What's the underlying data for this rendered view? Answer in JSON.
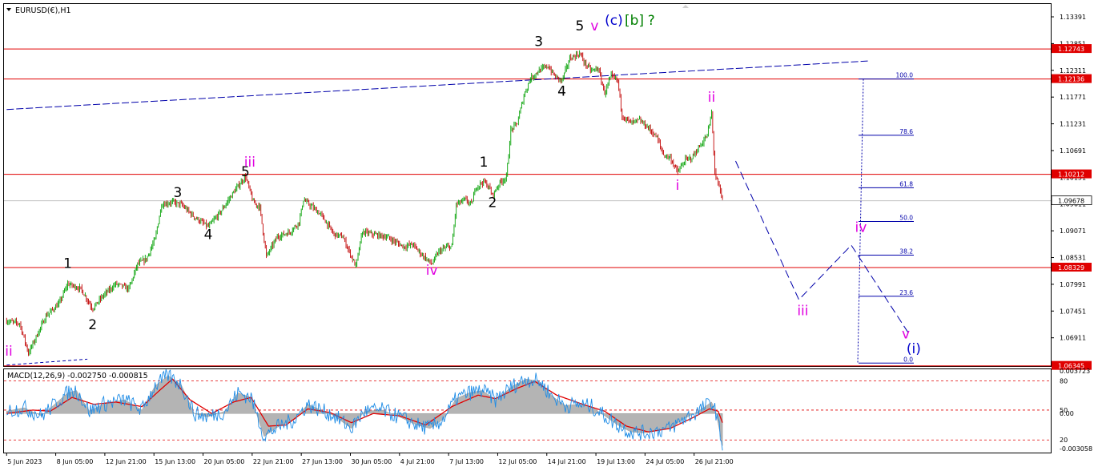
{
  "chart_data": {
    "type": "candlestick",
    "symbol_label": "EURUSD(€),H1",
    "price_panel": {
      "ylim": [
        1.0634,
        1.1365
      ],
      "y_ticks": [
        1.13391,
        1.12851,
        1.12311,
        1.11771,
        1.11231,
        1.10691,
        1.10151,
        1.09611,
        1.09071,
        1.08531,
        1.07991,
        1.07451,
        1.06911
      ],
      "y_tick_labels": [
        "1.13391",
        "1.12851",
        "1.12311",
        "1.11771",
        "1.11231",
        "1.10691",
        "1.10151",
        "1.09611",
        "1.09071",
        "1.08531",
        "1.07991",
        "1.07451",
        "1.06911"
      ],
      "horizontal_levels": [
        {
          "price": 1.12743,
          "label": "1.12743",
          "color": "#e00000"
        },
        {
          "price": 1.12136,
          "label": "1.12136",
          "color": "#e00000"
        },
        {
          "price": 1.10212,
          "label": "1.10212",
          "color": "#e00000"
        },
        {
          "price": 1.08329,
          "label": "1.08329",
          "color": "#e00000"
        },
        {
          "price": 1.06345,
          "label": "1.06345",
          "color": "#e00000"
        }
      ],
      "current_price": {
        "price": 1.09678,
        "label": "1.09678"
      },
      "fibonacci_levels": [
        {
          "label": "100.0",
          "price": 1.12136
        },
        {
          "label": "78.6",
          "price": 1.11
        },
        {
          "label": "61.8",
          "price": 1.0994
        },
        {
          "label": "50.0",
          "price": 1.0926
        },
        {
          "label": "38.2",
          "price": 1.0858
        },
        {
          "label": "23.6",
          "price": 1.0775
        },
        {
          "label": "0.0",
          "price": 1.064
        }
      ],
      "wave_labels": [
        {
          "text": "ii",
          "color": "#e000e0",
          "x": 0.5,
          "price": 1.0655
        },
        {
          "text": "1",
          "color": "#000000",
          "x": 14,
          "price": 1.0832
        },
        {
          "text": "2",
          "color": "#000000",
          "x": 19.7,
          "price": 1.0708
        },
        {
          "text": "3",
          "color": "#000000",
          "x": 39.2,
          "price": 1.0975
        },
        {
          "text": "4",
          "color": "#000000",
          "x": 46.2,
          "price": 1.089
        },
        {
          "text": "5",
          "color": "#000000",
          "x": 54.7,
          "price": 1.1017
        },
        {
          "text": "iii",
          "color": "#e000e0",
          "x": 55.7,
          "price": 1.1037
        },
        {
          "text": "iv",
          "color": "#e000e0",
          "x": 97.4,
          "price": 1.0818
        },
        {
          "text": "1",
          "color": "#000000",
          "x": 109.3,
          "price": 1.1037
        },
        {
          "text": "2",
          "color": "#000000",
          "x": 111.3,
          "price": 1.0955
        },
        {
          "text": "3",
          "color": "#000000",
          "x": 121.9,
          "price": 1.128
        },
        {
          "text": "4",
          "color": "#000000",
          "x": 127.2,
          "price": 1.118
        },
        {
          "text": "5",
          "color": "#000000",
          "x": 131.3,
          "price": 1.1312
        },
        {
          "text": "v",
          "color": "#e000e0",
          "x": 134.7,
          "price": 1.1312
        },
        {
          "text": "(c)",
          "color": "#0000cc",
          "x": 139.1,
          "price": 1.1323
        },
        {
          "text": "[b]",
          "color": "#008000",
          "x": 143.8,
          "price": 1.1323
        },
        {
          "text": "?",
          "color": "#008000",
          "x": 147.7,
          "price": 1.1323
        },
        {
          "text": "ii",
          "color": "#e000e0",
          "x": 161.5,
          "price": 1.1168
        },
        {
          "text": "i",
          "color": "#e000e0",
          "x": 153.7,
          "price": 1.099
        },
        {
          "text": "iii",
          "color": "#e000e0",
          "x": 182.4,
          "price": 1.0737
        },
        {
          "text": "iv",
          "color": "#e000e0",
          "x": 195.7,
          "price": 1.0905
        },
        {
          "text": "v",
          "color": "#e000e0",
          "x": 206.0,
          "price": 1.069
        },
        {
          "text": "(i)",
          "color": "#0000cc",
          "x": 207.8,
          "price": 1.066
        }
      ],
      "projection_path": [
        {
          "x": 167.0,
          "price": 1.1048
        },
        {
          "x": 181.5,
          "price": 1.0768
        },
        {
          "x": 193.5,
          "price": 1.0878
        },
        {
          "x": 206.5,
          "price": 1.0702
        }
      ],
      "trendlines": [
        {
          "color": "#0000aa",
          "dash": "long",
          "points": [
            {
              "x": 0,
              "price": 1.1152
            },
            {
              "x": 197.5,
              "price": 1.125
            }
          ]
        },
        {
          "color": "#0000aa",
          "dash": "short",
          "points": [
            {
              "x": 0,
              "price": 1.0636
            },
            {
              "x": 18.5,
              "price": 1.0648
            }
          ]
        }
      ],
      "candles": []
    },
    "price_anchors": [
      [
        0,
        1.0725
      ],
      [
        3,
        1.072
      ],
      [
        5,
        1.066
      ],
      [
        9,
        1.0735
      ],
      [
        12,
        1.076
      ],
      [
        14,
        1.08
      ],
      [
        17,
        1.079
      ],
      [
        19.7,
        1.075
      ],
      [
        22,
        1.0775
      ],
      [
        25,
        1.08
      ],
      [
        28,
        1.079
      ],
      [
        30,
        1.084
      ],
      [
        32,
        1.085
      ],
      [
        34,
        1.089
      ],
      [
        35.5,
        1.096
      ],
      [
        38,
        1.0965
      ],
      [
        40,
        1.096
      ],
      [
        43,
        1.0935
      ],
      [
        46.2,
        1.0915
      ],
      [
        49,
        1.0945
      ],
      [
        52,
        1.0985
      ],
      [
        54.7,
        1.1017
      ],
      [
        56.5,
        1.0965
      ],
      [
        58,
        1.0955
      ],
      [
        59.5,
        1.0855
      ],
      [
        62,
        1.0895
      ],
      [
        65,
        1.0905
      ],
      [
        67,
        1.0925
      ],
      [
        68,
        1.097
      ],
      [
        70,
        1.0955
      ],
      [
        72,
        1.094
      ],
      [
        75,
        1.09
      ],
      [
        77,
        1.0895
      ],
      [
        79,
        1.0855
      ],
      [
        80,
        1.0835
      ],
      [
        81.5,
        1.0905
      ],
      [
        84,
        1.09
      ],
      [
        87,
        1.0895
      ],
      [
        89,
        1.0885
      ],
      [
        91,
        1.0875
      ],
      [
        93,
        1.088
      ],
      [
        95,
        1.086
      ],
      [
        97.4,
        1.084
      ],
      [
        99,
        1.0865
      ],
      [
        101,
        1.0875
      ],
      [
        102,
        1.0875
      ],
      [
        103,
        1.096
      ],
      [
        105,
        1.097
      ],
      [
        106.5,
        1.096
      ],
      [
        107.5,
        1.0995
      ],
      [
        109.3,
        1.1007
      ],
      [
        110.5,
        1.0995
      ],
      [
        111.3,
        1.0978
      ],
      [
        113,
        1.1005
      ],
      [
        114.5,
        1.1015
      ],
      [
        115.5,
        1.111
      ],
      [
        117,
        1.1125
      ],
      [
        118.5,
        1.118
      ],
      [
        120,
        1.1215
      ],
      [
        121.9,
        1.123
      ],
      [
        124,
        1.124
      ],
      [
        125.5,
        1.122
      ],
      [
        127.2,
        1.121
      ],
      [
        129,
        1.1255
      ],
      [
        131.3,
        1.1265
      ],
      [
        132.5,
        1.1245
      ],
      [
        134,
        1.123
      ],
      [
        135.5,
        1.1235
      ],
      [
        137,
        1.1185
      ],
      [
        138.5,
        1.122
      ],
      [
        140,
        1.121
      ],
      [
        141,
        1.114
      ],
      [
        143,
        1.1125
      ],
      [
        145,
        1.113
      ],
      [
        147,
        1.1115
      ],
      [
        149,
        1.1095
      ],
      [
        150.5,
        1.106
      ],
      [
        152,
        1.1055
      ],
      [
        153.7,
        1.1025
      ],
      [
        155.5,
        1.105
      ],
      [
        157,
        1.1055
      ],
      [
        159,
        1.108
      ],
      [
        160.5,
        1.11
      ],
      [
        161.5,
        1.1145
      ],
      [
        162.3,
        1.102
      ],
      [
        163.4,
        1.099
      ],
      [
        164,
        1.0968
      ]
    ],
    "macd_panel": {
      "title": "MACD(12,26,9) -0.002750 -0.000815",
      "ylim": [
        -0.0034,
        0.00385
      ],
      "y_tick_labels": [
        {
          "label": "0.003723",
          "value": 0.003723
        },
        {
          "label": "80",
          "value": 0.00285
        },
        {
          "label": "50",
          "value": 0.0003
        },
        {
          "label": "0.00",
          "value": 1e-05
        },
        {
          "label": "20",
          "value": -0.0023
        },
        {
          "label": "-0.003058",
          "value": -0.003058
        }
      ],
      "dotted_levels": [
        0.00285,
        0.0003,
        -0.0023
      ],
      "macd_anchors": [
        [
          0,
          0.0002
        ],
        [
          4,
          0.0005
        ],
        [
          8,
          -0.0002
        ],
        [
          14,
          0.0018
        ],
        [
          16,
          0.002
        ],
        [
          19,
          0.0002
        ],
        [
          22,
          0.0008
        ],
        [
          27,
          0.0012
        ],
        [
          31,
          0.0003
        ],
        [
          34,
          0.0024
        ],
        [
          37,
          0.0033
        ],
        [
          40,
          0.0025
        ],
        [
          43,
          0.0
        ],
        [
          46,
          -0.0003
        ],
        [
          50,
          0.0002
        ],
        [
          53,
          0.0018
        ],
        [
          56,
          0.0014
        ],
        [
          59,
          -0.002
        ],
        [
          62,
          -0.0012
        ],
        [
          66,
          -0.0005
        ],
        [
          69,
          0.0008
        ],
        [
          72,
          0.0003
        ],
        [
          75,
          -0.0002
        ],
        [
          79,
          -0.0013
        ],
        [
          82,
          0.0002
        ],
        [
          86,
          0.0003
        ],
        [
          90,
          -0.0003
        ],
        [
          94,
          -0.001
        ],
        [
          97,
          -0.0013
        ],
        [
          100,
          -0.0005
        ],
        [
          103,
          0.0013
        ],
        [
          106,
          0.0018
        ],
        [
          109,
          0.002
        ],
        [
          112,
          0.0012
        ],
        [
          116,
          0.0024
        ],
        [
          119,
          0.003
        ],
        [
          122,
          0.0028
        ],
        [
          125,
          0.0015
        ],
        [
          128,
          0.0007
        ],
        [
          131,
          0.0008
        ],
        [
          134,
          0.0006
        ],
        [
          137,
          -0.0002
        ],
        [
          140,
          -0.001
        ],
        [
          143,
          -0.0016
        ],
        [
          146,
          -0.0017
        ],
        [
          149,
          -0.0015
        ],
        [
          152,
          -0.0013
        ],
        [
          155,
          -0.0005
        ],
        [
          158,
          0.0001
        ],
        [
          160,
          0.0006
        ],
        [
          161.5,
          0.001
        ],
        [
          162.5,
          0.0001
        ],
        [
          164,
          -0.0028
        ]
      ],
      "signal_anchors": [
        [
          0,
          0.0
        ],
        [
          6,
          0.0003
        ],
        [
          10,
          0.0002
        ],
        [
          15,
          0.0014
        ],
        [
          20,
          0.0008
        ],
        [
          25,
          0.001
        ],
        [
          31,
          0.0006
        ],
        [
          35,
          0.002
        ],
        [
          38,
          0.003
        ],
        [
          42,
          0.0012
        ],
        [
          47,
          0.0
        ],
        [
          52,
          0.001
        ],
        [
          56,
          0.0014
        ],
        [
          60,
          -0.0011
        ],
        [
          64,
          -0.001
        ],
        [
          69,
          0.0004
        ],
        [
          74,
          0.0001
        ],
        [
          79,
          -0.0008
        ],
        [
          84,
          0.0
        ],
        [
          90,
          -0.0002
        ],
        [
          96,
          -0.001
        ],
        [
          102,
          0.0006
        ],
        [
          108,
          0.0016
        ],
        [
          112,
          0.0013
        ],
        [
          117,
          0.0022
        ],
        [
          121,
          0.0028
        ],
        [
          126,
          0.0016
        ],
        [
          132,
          0.0008
        ],
        [
          137,
          0.0002
        ],
        [
          142,
          -0.0011
        ],
        [
          147,
          -0.0016
        ],
        [
          152,
          -0.0013
        ],
        [
          157,
          -0.0004
        ],
        [
          161,
          0.0004
        ],
        [
          163,
          0.0002
        ],
        [
          164,
          -0.0008
        ]
      ]
    },
    "x_ticks": [
      {
        "label": "5 Jun 2023",
        "x": 0
      },
      {
        "label": "8 Jun 05:00",
        "x": 11.25
      },
      {
        "label": "12 Jun 21:00",
        "x": 22.5
      },
      {
        "label": "15 Jun 13:00",
        "x": 33.75
      },
      {
        "label": "20 Jun 05:00",
        "x": 45
      },
      {
        "label": "22 Jun 21:00",
        "x": 56.25
      },
      {
        "label": "27 Jun 13:00",
        "x": 67.5
      },
      {
        "label": "30 Jun 05:00",
        "x": 78.75
      },
      {
        "label": "4 Jul 21:00",
        "x": 90
      },
      {
        "label": "7 Jul 13:00",
        "x": 101.25
      },
      {
        "label": "12 Jul 05:00",
        "x": 112.5
      },
      {
        "label": "14 Jul 21:00",
        "x": 123.75
      },
      {
        "label": "19 Jul 13:00",
        "x": 135
      },
      {
        "label": "24 Jul 05:00",
        "x": 146.25
      },
      {
        "label": "26 Jul 21:00",
        "x": 157.5
      }
    ],
    "x_range": [
      -0.6,
      239.2
    ],
    "colors": {
      "bull": "#00a000",
      "bear": "#c00000",
      "level_line": "#e00000",
      "trendline": "#0000aa",
      "fib": "#0000aa",
      "macd_hist": "#b4b4b4",
      "macd_signal": "#e00000",
      "macd_line": "#1e8ce6",
      "current_price_line": "#c0c0c0"
    }
  }
}
